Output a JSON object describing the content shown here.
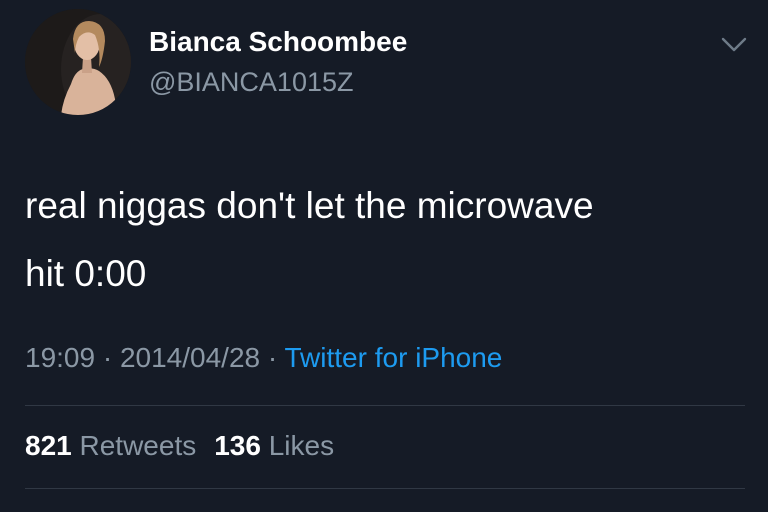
{
  "author": {
    "display_name": "Bianca Schoombee",
    "handle": "@BIANCA1015Z",
    "avatar_icon": "profile-photo"
  },
  "menu_icon": "chevron-down-icon",
  "tweet": {
    "text_line1": "real niggas don't let the microwave",
    "text_line2": "hit 0:00"
  },
  "meta": {
    "time": "19:09",
    "separator": " · ",
    "date": "2014/04/28",
    "source": "Twitter for iPhone"
  },
  "stats": {
    "retweets_count": "821",
    "retweets_label": "Retweets",
    "likes_count": "136",
    "likes_label": "Likes"
  },
  "colors": {
    "background": "#151b26",
    "secondary_text": "#8b98a5",
    "link": "#1d9bf0",
    "divider": "#303844"
  }
}
